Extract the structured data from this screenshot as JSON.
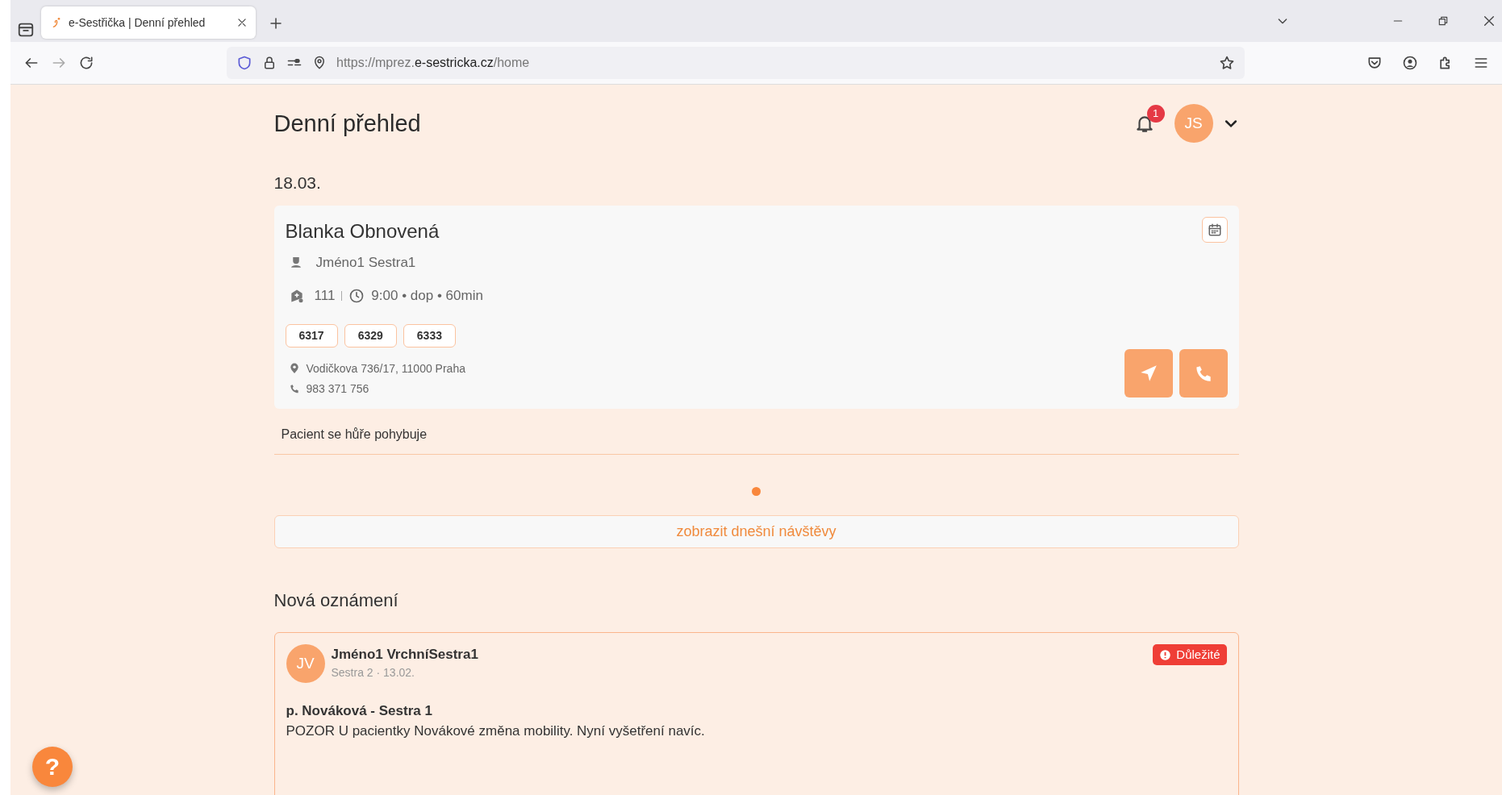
{
  "browser": {
    "tabs": [
      {
        "title": "e-Sestřička | Denní přehled",
        "selected": true
      }
    ],
    "url": {
      "prefix": "https://mprez.",
      "domain": "e-sestricka.cz",
      "path": "/home"
    }
  },
  "header": {
    "title": "Denní přehled",
    "notifications": "1",
    "user_initials": "JS"
  },
  "date": "18.03.",
  "visits": [
    {
      "patient": "Blanka Obnovená",
      "nurse": "Jméno1 Sestra1",
      "room": "111",
      "time": "9:00 • dop • 60min",
      "codes": [
        "6317",
        "6329",
        "6333"
      ],
      "address": "Vodičkova 736/17, 11000 Praha",
      "phone": "983 371 756",
      "note": "Pacient se hůře pohybuje"
    }
  ],
  "carousel_dots": [
    {
      "selected": true
    }
  ],
  "show_visits_button": "zobrazit dnešní návštěvy",
  "announcements_title": "Nová oznámení",
  "announcements": [
    {
      "initials": "JV",
      "author": "Jméno1 VrchníSestra1",
      "meta": "Sestra 2 · 13.02.",
      "kind": "important",
      "badge": "Důležité",
      "title": "p. Nováková - Sestra 1",
      "body": "POZOR U pacientky Novákové změna mobility. Nyní vyšetření navíc."
    }
  ],
  "help_button": "?"
}
